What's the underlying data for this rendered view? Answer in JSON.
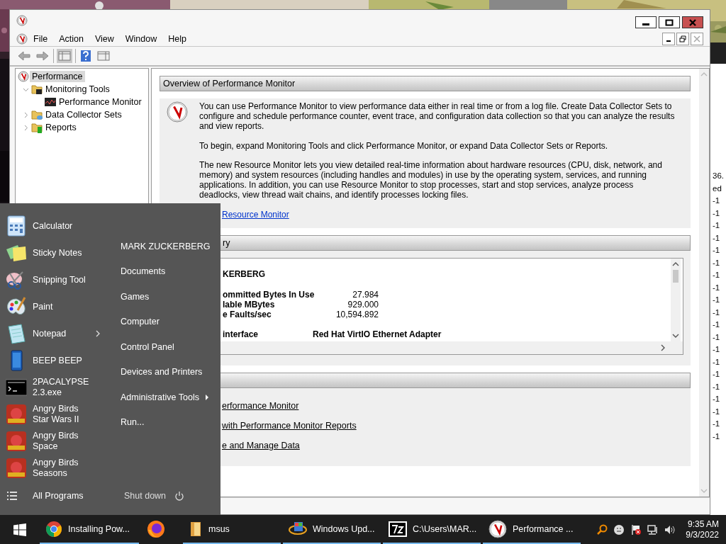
{
  "window": {
    "menu": [
      "File",
      "Action",
      "View",
      "Window",
      "Help"
    ]
  },
  "tree": [
    {
      "label": "Performance",
      "kind": "gauge",
      "selected": true,
      "children": [
        {
          "label": "Monitoring Tools",
          "kind": "folder-tools",
          "selected": false,
          "expanded": true,
          "children": [
            {
              "label": "Performance Monitor",
              "kind": "chart",
              "selected": false
            }
          ]
        },
        {
          "label": "Data Collector Sets",
          "kind": "folder-data",
          "selected": false,
          "expanded": false
        },
        {
          "label": "Reports",
          "kind": "folder-reports",
          "selected": false,
          "expanded": false
        }
      ]
    }
  ],
  "overview": {
    "header": "Overview of Performance Monitor",
    "paragraphs": [
      "You can use Performance Monitor to view performance data either in real time or from a log file. Create Data Collector Sets to configure and schedule performance counter, event trace, and configuration data collection so that you can analyze the results and view reports.",
      "To begin, expand Monitoring Tools and click Performance Monitor, or expand Data Collector Sets or Reports.",
      "The new Resource Monitor lets you view detailed real-time information about hardware resources (CPU, disk, network, and memory) and system resources (including handles and modules) in use by the operating system, services, and running applications. In addition, you can use Resource Monitor to stop processes, start and stop services, analyze process deadlocks, view thread wait chains, and identify processes locking files."
    ],
    "link": "Resource Monitor"
  },
  "summary": {
    "header": "ry",
    "machine": "KERBERG",
    "rows": [
      {
        "label": "ommitted Bytes In Use",
        "value": "27.984"
      },
      {
        "label": "lable MBytes",
        "value": "929.000"
      },
      {
        "label": "e Faults/sec",
        "value": "10,594.892"
      }
    ],
    "interface_label": "interface",
    "interface_value": "Red Hat VirtIO Ethernet Adapter"
  },
  "tasks": {
    "links": [
      "erformance Monitor",
      "with Performance Monitor Reports",
      "e and Manage Data"
    ]
  },
  "start_menu": {
    "programs": [
      {
        "label": "Calculator",
        "kind": "calculator",
        "submenu": false
      },
      {
        "label": "Sticky Notes",
        "kind": "notes",
        "submenu": false
      },
      {
        "label": "Snipping Tool",
        "kind": "scissors",
        "submenu": false
      },
      {
        "label": "Paint",
        "kind": "palette",
        "submenu": false
      },
      {
        "label": "Notepad",
        "kind": "notepad",
        "submenu": true
      },
      {
        "label": "BEEP BEEP",
        "kind": "phone",
        "submenu": false
      },
      {
        "label": "2PACALYPSE 2.3.exe",
        "kind": "console",
        "submenu": false
      },
      {
        "label": "Angry Birds Star Wars II",
        "kind": "game",
        "submenu": false
      },
      {
        "label": "Angry Birds Space",
        "kind": "game",
        "submenu": false
      },
      {
        "label": "Angry Birds Seasons",
        "kind": "game",
        "submenu": false
      }
    ],
    "places": [
      {
        "label": "MARK ZUCKERBERG",
        "submenu": false
      },
      {
        "label": "Documents",
        "submenu": false
      },
      {
        "label": "Games",
        "submenu": false
      },
      {
        "label": "Computer",
        "submenu": false
      },
      {
        "label": "Control Panel",
        "submenu": false
      },
      {
        "label": "Devices and Printers",
        "submenu": false
      },
      {
        "label": "Administrative Tools",
        "submenu": true
      },
      {
        "label": "Run...",
        "submenu": false
      }
    ],
    "all_programs": "All Programs",
    "shut_down": "Shut down"
  },
  "taskbar": {
    "items": [
      {
        "kind": "chrome",
        "label": "Installing Pow...",
        "running": true
      },
      {
        "kind": "firefox",
        "running": false
      },
      {
        "kind": "folder",
        "label": "msus",
        "running": true
      },
      {
        "kind": "update",
        "label": "Windows Upd...",
        "running": true
      },
      {
        "kind": "zip",
        "label": "C:\\Users\\MAR...",
        "running": true
      },
      {
        "kind": "gauge",
        "label": "Performance ...",
        "running": true
      }
    ],
    "time": "9:35 AM",
    "date": "9/3/2022"
  },
  "background_window": {
    "lines": [
      "36.",
      "ed",
      "-1",
      "-1",
      "-1",
      "-1",
      "-1",
      "-1",
      "-1",
      "-1",
      "-1",
      "-1",
      "-1",
      "-1",
      "-1",
      "-1",
      "-1",
      "-1",
      "-1",
      "-1",
      "-1",
      "-1"
    ]
  }
}
